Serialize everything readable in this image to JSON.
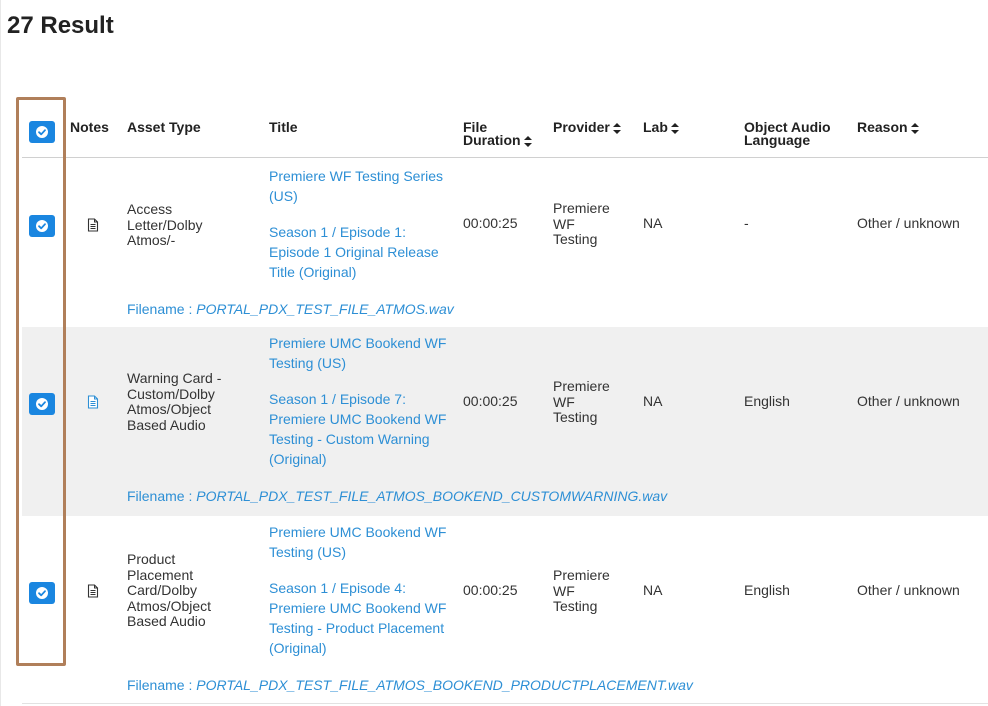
{
  "page": {
    "result_count": "27 Result"
  },
  "colors": {
    "accent": "#1a86e0",
    "link": "#2d8fd5",
    "highlight_border": "#b07f5a",
    "row_shade": "#f0f0f0"
  },
  "table": {
    "headers": {
      "notes": "Notes",
      "asset_type": "Asset Type",
      "title": "Title",
      "file_duration_1": "File",
      "file_duration_2": "Duration",
      "provider": "Provider",
      "lab": "Lab",
      "object_audio_language_1": "Object Audio",
      "object_audio_language_2": "Language",
      "reason": "Reason"
    },
    "filename_label": "Filename : ",
    "rows": [
      {
        "checked": true,
        "note_icon": "document-icon",
        "asset_type": [
          "Access",
          "Letter/Dolby",
          "Atmos/-"
        ],
        "series_title": "Premiere WF Testing Series (US)",
        "episode_title": "Season 1 / Episode 1: Episode 1 Original Release Title (Original)",
        "duration": "00:00:25",
        "provider": [
          "Premiere",
          "WF",
          "Testing"
        ],
        "lab": "NA",
        "language": "-",
        "reason": "Other / unknown",
        "filename": "PORTAL_PDX_TEST_FILE_ATMOS.wav"
      },
      {
        "checked": true,
        "note_icon": "document-icon",
        "asset_type": [
          "Warning Card -",
          "Custom/Dolby",
          "Atmos/Object",
          "Based Audio"
        ],
        "series_title": "Premiere UMC Bookend WF Testing (US)",
        "episode_title": "Season 1 / Episode 7: Premiere UMC Bookend WF Testing - Custom Warning (Original)",
        "duration": "00:00:25",
        "provider": [
          "Premiere",
          "WF",
          "Testing"
        ],
        "lab": "NA",
        "language": "English",
        "reason": "Other / unknown",
        "filename": "PORTAL_PDX_TEST_FILE_ATMOS_BOOKEND_CUSTOMWARNING.wav"
      },
      {
        "checked": true,
        "note_icon": "document-icon",
        "asset_type": [
          "Product",
          "Placement",
          "Card/Dolby",
          "Atmos/Object",
          "Based Audio"
        ],
        "series_title": "Premiere UMC Bookend WF Testing (US)",
        "episode_title": "Season 1 / Episode 4: Premiere UMC Bookend WF Testing - Product Placement (Original)",
        "duration": "00:00:25",
        "provider": [
          "Premiere",
          "WF",
          "Testing"
        ],
        "lab": "NA",
        "language": "English",
        "reason": "Other / unknown",
        "filename": "PORTAL_PDX_TEST_FILE_ATMOS_BOOKEND_PRODUCTPLACEMENT.wav"
      }
    ]
  }
}
